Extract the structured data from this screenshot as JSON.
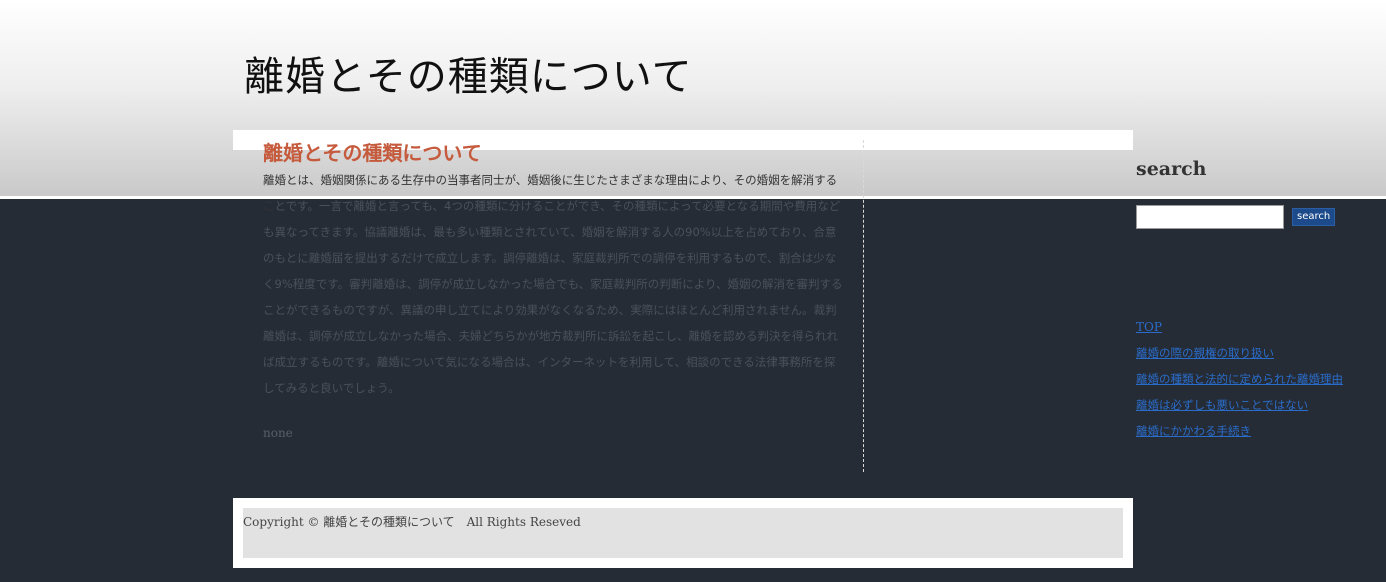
{
  "site": {
    "title": "離婚とその種類について"
  },
  "article": {
    "title": "離婚とその種類について",
    "lead": "離婚とは、婚姻関係にある生存中の当事者同士が、婚姻後に生じたさまざまな理由により、その婚姻を解消するこ",
    "body": "とです。一言で離婚と言っても、4つの種類に分けることができ、その種類によって必要となる期間や費用なども異なってきます。協議離婚は、最も多い種類とされていて、婚姻を解消する人の90%以上を占めており、合意のもとに離婚届を提出するだけで成立します。調停離婚は、家庭裁判所での調停を利用するもので、割合は少なく9%程度です。審判離婚は、調停が成立しなかった場合でも、家庭裁判所の判断により、婚姻の解消を審判することができるものですが、異議の申し立てにより効果がなくなるため、実際にはほとんど利用されません。裁判離婚は、調停が成立しなかった場合、夫婦どちらかが地方裁判所に訴訟を起こし、離婚を認める判決を得られれば成立するものです。離婚について気になる場合は、インターネットを利用して、相談のできる法律事務所を探してみると良いでしょう。",
    "footer_text": "none"
  },
  "sidebar": {
    "search_heading": "search",
    "search_button": "search",
    "nav": [
      "TOP",
      "離婚の際の親権の取り扱い",
      "離婚の種類と法的に定められた離婚理由",
      "離婚は必ずしも悪いことではない",
      "離婚にかかわる手続き"
    ]
  },
  "footer": {
    "copyright": "Copyright © 離婚とその種類について　All Rights Reseved"
  }
}
